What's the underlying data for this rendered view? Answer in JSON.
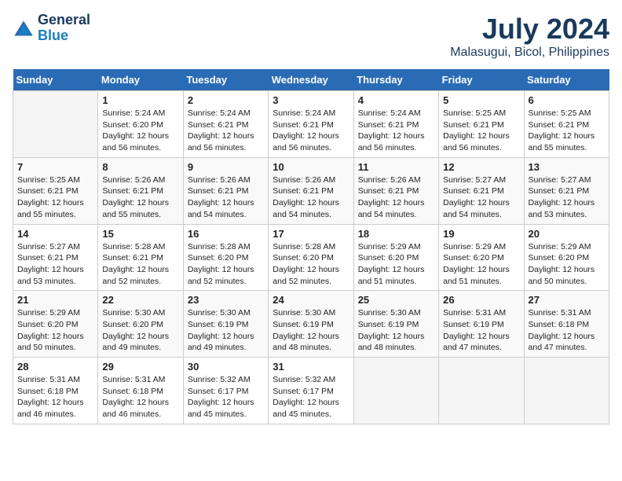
{
  "header": {
    "logo_line1": "General",
    "logo_line2": "Blue",
    "month_year": "July 2024",
    "location": "Malasugui, Bicol, Philippines"
  },
  "days_of_week": [
    "Sunday",
    "Monday",
    "Tuesday",
    "Wednesday",
    "Thursday",
    "Friday",
    "Saturday"
  ],
  "weeks": [
    [
      {
        "day": "",
        "info": ""
      },
      {
        "day": "1",
        "info": "Sunrise: 5:24 AM\nSunset: 6:20 PM\nDaylight: 12 hours\nand 56 minutes."
      },
      {
        "day": "2",
        "info": "Sunrise: 5:24 AM\nSunset: 6:21 PM\nDaylight: 12 hours\nand 56 minutes."
      },
      {
        "day": "3",
        "info": "Sunrise: 5:24 AM\nSunset: 6:21 PM\nDaylight: 12 hours\nand 56 minutes."
      },
      {
        "day": "4",
        "info": "Sunrise: 5:24 AM\nSunset: 6:21 PM\nDaylight: 12 hours\nand 56 minutes."
      },
      {
        "day": "5",
        "info": "Sunrise: 5:25 AM\nSunset: 6:21 PM\nDaylight: 12 hours\nand 56 minutes."
      },
      {
        "day": "6",
        "info": "Sunrise: 5:25 AM\nSunset: 6:21 PM\nDaylight: 12 hours\nand 55 minutes."
      }
    ],
    [
      {
        "day": "7",
        "info": "Sunrise: 5:25 AM\nSunset: 6:21 PM\nDaylight: 12 hours\nand 55 minutes."
      },
      {
        "day": "8",
        "info": "Sunrise: 5:26 AM\nSunset: 6:21 PM\nDaylight: 12 hours\nand 55 minutes."
      },
      {
        "day": "9",
        "info": "Sunrise: 5:26 AM\nSunset: 6:21 PM\nDaylight: 12 hours\nand 54 minutes."
      },
      {
        "day": "10",
        "info": "Sunrise: 5:26 AM\nSunset: 6:21 PM\nDaylight: 12 hours\nand 54 minutes."
      },
      {
        "day": "11",
        "info": "Sunrise: 5:26 AM\nSunset: 6:21 PM\nDaylight: 12 hours\nand 54 minutes."
      },
      {
        "day": "12",
        "info": "Sunrise: 5:27 AM\nSunset: 6:21 PM\nDaylight: 12 hours\nand 54 minutes."
      },
      {
        "day": "13",
        "info": "Sunrise: 5:27 AM\nSunset: 6:21 PM\nDaylight: 12 hours\nand 53 minutes."
      }
    ],
    [
      {
        "day": "14",
        "info": "Sunrise: 5:27 AM\nSunset: 6:21 PM\nDaylight: 12 hours\nand 53 minutes."
      },
      {
        "day": "15",
        "info": "Sunrise: 5:28 AM\nSunset: 6:21 PM\nDaylight: 12 hours\nand 52 minutes."
      },
      {
        "day": "16",
        "info": "Sunrise: 5:28 AM\nSunset: 6:20 PM\nDaylight: 12 hours\nand 52 minutes."
      },
      {
        "day": "17",
        "info": "Sunrise: 5:28 AM\nSunset: 6:20 PM\nDaylight: 12 hours\nand 52 minutes."
      },
      {
        "day": "18",
        "info": "Sunrise: 5:29 AM\nSunset: 6:20 PM\nDaylight: 12 hours\nand 51 minutes."
      },
      {
        "day": "19",
        "info": "Sunrise: 5:29 AM\nSunset: 6:20 PM\nDaylight: 12 hours\nand 51 minutes."
      },
      {
        "day": "20",
        "info": "Sunrise: 5:29 AM\nSunset: 6:20 PM\nDaylight: 12 hours\nand 50 minutes."
      }
    ],
    [
      {
        "day": "21",
        "info": "Sunrise: 5:29 AM\nSunset: 6:20 PM\nDaylight: 12 hours\nand 50 minutes."
      },
      {
        "day": "22",
        "info": "Sunrise: 5:30 AM\nSunset: 6:20 PM\nDaylight: 12 hours\nand 49 minutes."
      },
      {
        "day": "23",
        "info": "Sunrise: 5:30 AM\nSunset: 6:19 PM\nDaylight: 12 hours\nand 49 minutes."
      },
      {
        "day": "24",
        "info": "Sunrise: 5:30 AM\nSunset: 6:19 PM\nDaylight: 12 hours\nand 48 minutes."
      },
      {
        "day": "25",
        "info": "Sunrise: 5:30 AM\nSunset: 6:19 PM\nDaylight: 12 hours\nand 48 minutes."
      },
      {
        "day": "26",
        "info": "Sunrise: 5:31 AM\nSunset: 6:19 PM\nDaylight: 12 hours\nand 47 minutes."
      },
      {
        "day": "27",
        "info": "Sunrise: 5:31 AM\nSunset: 6:18 PM\nDaylight: 12 hours\nand 47 minutes."
      }
    ],
    [
      {
        "day": "28",
        "info": "Sunrise: 5:31 AM\nSunset: 6:18 PM\nDaylight: 12 hours\nand 46 minutes."
      },
      {
        "day": "29",
        "info": "Sunrise: 5:31 AM\nSunset: 6:18 PM\nDaylight: 12 hours\nand 46 minutes."
      },
      {
        "day": "30",
        "info": "Sunrise: 5:32 AM\nSunset: 6:17 PM\nDaylight: 12 hours\nand 45 minutes."
      },
      {
        "day": "31",
        "info": "Sunrise: 5:32 AM\nSunset: 6:17 PM\nDaylight: 12 hours\nand 45 minutes."
      },
      {
        "day": "",
        "info": ""
      },
      {
        "day": "",
        "info": ""
      },
      {
        "day": "",
        "info": ""
      }
    ]
  ]
}
